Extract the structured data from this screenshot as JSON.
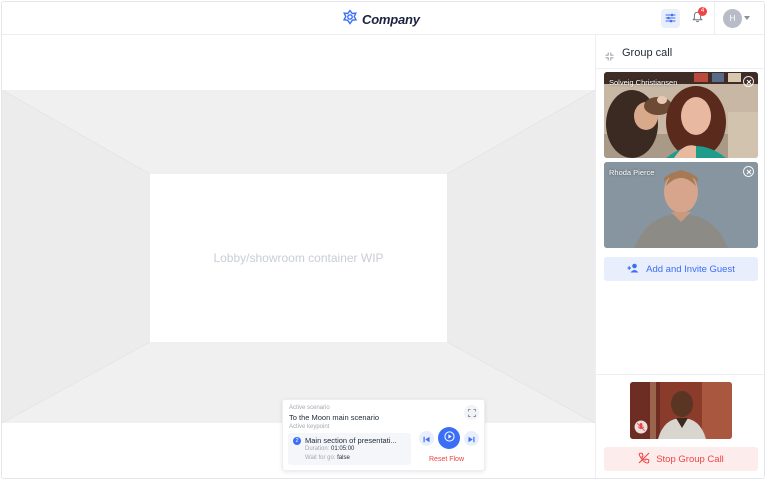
{
  "header": {
    "brand_name": "Company",
    "notification_count": "4",
    "user_initial": "H"
  },
  "stage": {
    "placeholder_text": "Lobby/showroom container WIP"
  },
  "flow": {
    "scenario_label": "Active scenario",
    "scenario_value": "To the Moon main scenario",
    "keypoint_label": "Active keypoint",
    "keypoint_number": "2",
    "keypoint_title": "Main section of presentati...",
    "duration_label": "Duration:",
    "duration_value": "01:05:00",
    "wait_label": "Wait for go:",
    "wait_value": "false",
    "reset_label": "Reset Flow"
  },
  "group_call": {
    "title": "Group call",
    "participants": [
      {
        "name": "Solveig Christiansen"
      },
      {
        "name": "Rhoda Pierce"
      }
    ],
    "invite_label": "Add and Invite Guest",
    "stop_label": "Stop Group Call"
  },
  "colors": {
    "accent": "#3b6ef6",
    "danger": "#ef4444",
    "accent_soft": "#e8eefc",
    "danger_soft": "#fdecec"
  },
  "icons": {
    "brand": "snowflake-logo-icon",
    "filter": "sliders-icon",
    "notifications": "bell-icon",
    "minimize": "minimize-icon",
    "invite": "user-plus-icon",
    "stop": "phone-off-icon",
    "muted": "mic-off-icon"
  }
}
